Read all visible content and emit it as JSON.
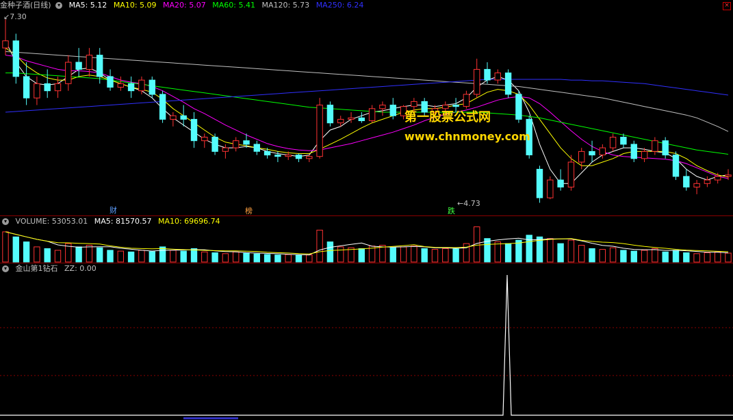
{
  "main_header": {
    "title": "金种子酒(日线)",
    "ma5": "MA5: 5.12",
    "ma10": "MA10: 5.09",
    "ma20": "MA20: 5.07",
    "ma60": "MA60: 5.41",
    "ma120": "MA120: 5.73",
    "ma250": "MA250: 6.24"
  },
  "volume_header": {
    "volume": "VOLUME: 53053.01",
    "ma5": "MA5: 81570.57",
    "ma10": "MA10: 69696.74"
  },
  "indicator_header": {
    "name": "金山第1钻石",
    "zz": "ZZ: 0.00"
  },
  "watermark": {
    "line1": "第一股票公式网",
    "line2": "www.chnmoney.com"
  },
  "markers": {
    "high_price": "7.30",
    "low_price": "4.73",
    "tag_cai": "财",
    "tag_bang": "榜",
    "tag_die": "跌"
  },
  "colors": {
    "up": "#ff3232",
    "down": "#54fcfc",
    "ma5": "#ffffff",
    "ma10": "#ffff00",
    "ma20": "#ff00ff",
    "ma60": "#00ff00",
    "ma120": "#c0c0c0",
    "ma250": "#3030ff"
  },
  "chart_data": [
    {
      "type": "candlestick",
      "title": "金种子酒(日线)",
      "ylim": [
        4.6,
        7.4
      ],
      "candles": [
        [
          6.9,
          7.3,
          7.0,
          6.8
        ],
        [
          7.0,
          7.1,
          6.5,
          6.4
        ],
        [
          6.5,
          6.7,
          6.2,
          6.1
        ],
        [
          6.2,
          6.5,
          6.4,
          6.1
        ],
        [
          6.4,
          6.6,
          6.3,
          6.2
        ],
        [
          6.3,
          6.5,
          6.4,
          6.2
        ],
        [
          6.4,
          6.8,
          6.7,
          6.3
        ],
        [
          6.7,
          6.9,
          6.6,
          6.5
        ],
        [
          6.6,
          6.9,
          6.8,
          6.5
        ],
        [
          6.8,
          6.9,
          6.5,
          6.4
        ],
        [
          6.5,
          6.6,
          6.35,
          6.3
        ],
        [
          6.35,
          6.5,
          6.4,
          6.3
        ],
        [
          6.4,
          6.5,
          6.3,
          6.2
        ],
        [
          6.3,
          6.5,
          6.45,
          6.25
        ],
        [
          6.45,
          6.5,
          6.25,
          6.2
        ],
        [
          6.25,
          6.3,
          5.9,
          5.85
        ],
        [
          5.9,
          6.0,
          5.95,
          5.8
        ],
        [
          5.95,
          6.1,
          5.9,
          5.8
        ],
        [
          5.9,
          6.0,
          5.6,
          5.5
        ],
        [
          5.6,
          5.7,
          5.65,
          5.5
        ],
        [
          5.65,
          5.7,
          5.45,
          5.4
        ],
        [
          5.45,
          5.55,
          5.5,
          5.35
        ],
        [
          5.5,
          5.65,
          5.6,
          5.45
        ],
        [
          5.6,
          5.7,
          5.55,
          5.5
        ],
        [
          5.55,
          5.6,
          5.45,
          5.4
        ],
        [
          5.45,
          5.5,
          5.4,
          5.35
        ],
        [
          5.4,
          5.45,
          5.38,
          5.3
        ],
        [
          5.38,
          5.45,
          5.4,
          5.33
        ],
        [
          5.4,
          5.42,
          5.35,
          5.3
        ],
        [
          5.35,
          5.4,
          5.38,
          5.3
        ],
        [
          5.38,
          6.2,
          6.1,
          5.35
        ],
        [
          6.1,
          6.15,
          5.85,
          5.8
        ],
        [
          5.85,
          5.95,
          5.9,
          5.8
        ],
        [
          5.9,
          6.0,
          5.92,
          5.85
        ],
        [
          5.92,
          6.0,
          5.88,
          5.85
        ],
        [
          5.88,
          6.1,
          6.05,
          5.85
        ],
        [
          6.05,
          6.15,
          6.1,
          5.95
        ],
        [
          6.1,
          6.2,
          5.95,
          5.9
        ],
        [
          5.95,
          6.1,
          6.08,
          5.9
        ],
        [
          6.08,
          6.2,
          6.15,
          6.0
        ],
        [
          6.15,
          6.2,
          6.0,
          5.95
        ],
        [
          6.0,
          6.1,
          6.05,
          5.95
        ],
        [
          6.05,
          6.15,
          6.1,
          6.0
        ],
        [
          6.1,
          6.2,
          6.08,
          6.0
        ],
        [
          6.08,
          6.3,
          6.25,
          6.05
        ],
        [
          6.25,
          6.75,
          6.6,
          6.2
        ],
        [
          6.6,
          6.7,
          6.45,
          6.4
        ],
        [
          6.45,
          6.6,
          6.55,
          6.4
        ],
        [
          6.55,
          6.6,
          6.25,
          6.2
        ],
        [
          6.25,
          6.3,
          5.9,
          5.85
        ],
        [
          5.9,
          5.95,
          5.4,
          5.35
        ],
        [
          5.2,
          5.25,
          4.8,
          4.73
        ],
        [
          4.8,
          5.1,
          5.05,
          4.78
        ],
        [
          5.05,
          5.2,
          4.95,
          4.9
        ],
        [
          4.95,
          5.4,
          5.3,
          4.9
        ],
        [
          5.3,
          5.5,
          5.45,
          5.2
        ],
        [
          5.45,
          5.6,
          5.4,
          5.3
        ],
        [
          5.4,
          5.55,
          5.5,
          5.35
        ],
        [
          5.5,
          5.7,
          5.65,
          5.45
        ],
        [
          5.65,
          5.7,
          5.55,
          5.5
        ],
        [
          5.55,
          5.6,
          5.35,
          5.3
        ],
        [
          5.35,
          5.5,
          5.45,
          5.3
        ],
        [
          5.45,
          5.65,
          5.6,
          5.4
        ],
        [
          5.6,
          5.65,
          5.4,
          5.35
        ],
        [
          5.4,
          5.45,
          5.1,
          5.05
        ],
        [
          5.1,
          5.2,
          4.95,
          4.9
        ],
        [
          4.95,
          5.05,
          5.0,
          4.85
        ],
        [
          5.0,
          5.1,
          5.05,
          4.95
        ],
        [
          5.05,
          5.15,
          5.1,
          5.0
        ],
        [
          5.1,
          5.2,
          5.12,
          5.05
        ]
      ],
      "ma_series": [
        {
          "name": "MA5",
          "values": [
            7.0,
            6.7,
            6.5,
            6.4,
            6.38,
            6.4,
            6.5,
            6.6,
            6.62,
            6.55,
            6.45,
            6.4,
            6.35,
            6.3,
            6.2,
            6.05,
            5.92,
            5.82,
            5.72,
            5.62,
            5.55,
            5.5,
            5.5,
            5.52,
            5.5,
            5.45,
            5.42,
            5.4,
            5.38,
            5.4,
            5.6,
            5.75,
            5.8,
            5.9,
            5.95,
            6.0,
            6.02,
            6.05,
            6.08,
            6.1,
            6.1,
            6.08,
            6.1,
            6.12,
            6.2,
            6.35,
            6.45,
            6.5,
            6.45,
            6.3,
            6.0,
            5.55,
            5.2,
            5.0,
            5.0,
            5.15,
            5.3,
            5.4,
            5.45,
            5.5,
            5.5,
            5.48,
            5.45,
            5.43,
            5.35,
            5.2,
            5.1,
            5.05,
            5.1,
            5.12
          ]
        },
        {
          "name": "MA10",
          "values": [
            6.9,
            6.8,
            6.65,
            6.55,
            6.48,
            6.45,
            6.45,
            6.5,
            6.52,
            6.5,
            6.45,
            6.4,
            6.35,
            6.32,
            6.28,
            6.18,
            6.05,
            5.95,
            5.85,
            5.75,
            5.65,
            5.58,
            5.55,
            5.53,
            5.5,
            5.48,
            5.45,
            5.43,
            5.42,
            5.42,
            5.48,
            5.55,
            5.62,
            5.7,
            5.78,
            5.85,
            5.9,
            5.95,
            6.0,
            6.03,
            6.05,
            6.05,
            6.07,
            6.1,
            6.12,
            6.2,
            6.28,
            6.32,
            6.3,
            6.25,
            6.1,
            5.9,
            5.7,
            5.5,
            5.35,
            5.25,
            5.25,
            5.3,
            5.35,
            5.42,
            5.45,
            5.45,
            5.45,
            5.45,
            5.42,
            5.35,
            5.25,
            5.18,
            5.12,
            5.09
          ]
        },
        {
          "name": "MA20",
          "values": [
            6.8,
            6.78,
            6.72,
            6.68,
            6.64,
            6.6,
            6.58,
            6.58,
            6.57,
            6.55,
            6.5,
            6.45,
            6.42,
            6.4,
            6.36,
            6.3,
            6.22,
            6.14,
            6.05,
            5.98,
            5.9,
            5.82,
            5.75,
            5.68,
            5.62,
            5.56,
            5.52,
            5.49,
            5.47,
            5.46,
            5.47,
            5.5,
            5.53,
            5.56,
            5.6,
            5.64,
            5.68,
            5.72,
            5.77,
            5.82,
            5.88,
            5.93,
            5.97,
            6.0,
            6.03,
            6.07,
            6.12,
            6.17,
            6.2,
            6.22,
            6.2,
            6.12,
            6.0,
            5.87,
            5.74,
            5.62,
            5.52,
            5.45,
            5.4,
            5.38,
            5.37,
            5.36,
            5.35,
            5.34,
            5.32,
            5.28,
            5.22,
            5.16,
            5.1,
            5.07
          ]
        },
        {
          "name": "MA60",
          "values": [
            6.55,
            6.55,
            6.54,
            6.53,
            6.52,
            6.51,
            6.5,
            6.49,
            6.48,
            6.47,
            6.45,
            6.43,
            6.41,
            6.39,
            6.37,
            6.35,
            6.33,
            6.31,
            6.29,
            6.27,
            6.25,
            6.23,
            6.21,
            6.19,
            6.17,
            6.15,
            6.13,
            6.11,
            6.09,
            6.07,
            6.06,
            6.05,
            6.04,
            6.03,
            6.02,
            6.01,
            6.0,
            6.0,
            6.0,
            6.0,
            6.0,
            6.0,
            6.0,
            6.0,
            6.0,
            6.0,
            5.99,
            5.98,
            5.97,
            5.96,
            5.94,
            5.92,
            5.89,
            5.86,
            5.83,
            5.8,
            5.77,
            5.74,
            5.71,
            5.68,
            5.65,
            5.62,
            5.59,
            5.56,
            5.53,
            5.5,
            5.47,
            5.45,
            5.43,
            5.41
          ]
        },
        {
          "name": "MA120",
          "values": [
            6.85,
            6.84,
            6.83,
            6.82,
            6.81,
            6.8,
            6.79,
            6.78,
            6.77,
            6.76,
            6.75,
            6.74,
            6.73,
            6.72,
            6.71,
            6.7,
            6.69,
            6.68,
            6.67,
            6.66,
            6.65,
            6.64,
            6.63,
            6.62,
            6.61,
            6.6,
            6.59,
            6.58,
            6.57,
            6.56,
            6.55,
            6.54,
            6.53,
            6.52,
            6.51,
            6.5,
            6.49,
            6.48,
            6.47,
            6.46,
            6.45,
            6.44,
            6.43,
            6.42,
            6.41,
            6.4,
            6.39,
            6.38,
            6.37,
            6.36,
            6.34,
            6.32,
            6.3,
            6.28,
            6.26,
            6.24,
            6.22,
            6.2,
            6.17,
            6.14,
            6.11,
            6.08,
            6.05,
            6.02,
            5.99,
            5.96,
            5.92,
            5.86,
            5.8,
            5.73
          ]
        },
        {
          "name": "MA250",
          "values": [
            6.0,
            6.01,
            6.02,
            6.03,
            6.04,
            6.05,
            6.06,
            6.07,
            6.08,
            6.09,
            6.1,
            6.11,
            6.12,
            6.13,
            6.14,
            6.15,
            6.16,
            6.17,
            6.18,
            6.19,
            6.2,
            6.21,
            6.22,
            6.23,
            6.24,
            6.25,
            6.26,
            6.27,
            6.28,
            6.29,
            6.3,
            6.31,
            6.32,
            6.33,
            6.34,
            6.35,
            6.36,
            6.37,
            6.38,
            6.39,
            6.4,
            6.41,
            6.42,
            6.43,
            6.44,
            6.45,
            6.46,
            6.46,
            6.46,
            6.46,
            6.46,
            6.46,
            6.46,
            6.46,
            6.45,
            6.45,
            6.44,
            6.44,
            6.43,
            6.42,
            6.41,
            6.4,
            6.38,
            6.36,
            6.34,
            6.32,
            6.3,
            6.28,
            6.26,
            6.24
          ]
        }
      ]
    },
    {
      "type": "bar",
      "title": "VOLUME",
      "ylim": [
        0,
        200000
      ],
      "values": [
        180000,
        150000,
        120000,
        90000,
        80000,
        70000,
        110000,
        90000,
        100000,
        85000,
        70000,
        65000,
        60000,
        70000,
        62000,
        90000,
        70000,
        65000,
        80000,
        60000,
        55000,
        50000,
        60000,
        52000,
        48000,
        45000,
        42000,
        44000,
        40000,
        42000,
        190000,
        120000,
        90000,
        85000,
        80000,
        95000,
        100000,
        85000,
        90000,
        95000,
        80000,
        75000,
        80000,
        78000,
        110000,
        210000,
        140000,
        120000,
        110000,
        130000,
        160000,
        150000,
        140000,
        110000,
        130000,
        100000,
        80000,
        75000,
        85000,
        70000,
        65000,
        70000,
        80000,
        60000,
        70000,
        55000,
        50000,
        55000,
        60000,
        53053
      ]
    },
    {
      "type": "line",
      "title": "金山第1钻石",
      "ylim": [
        0,
        1
      ],
      "values": [
        0,
        0,
        0,
        0,
        0,
        0,
        0,
        0,
        0,
        0,
        0,
        0,
        0,
        0,
        0,
        0,
        0,
        0,
        0,
        0,
        0,
        0,
        0,
        0,
        0,
        0,
        0,
        0,
        0,
        0,
        0,
        0,
        0,
        0,
        0,
        0,
        0,
        0,
        0,
        0,
        0,
        0,
        0,
        0,
        0,
        0,
        0,
        0,
        0,
        0,
        0,
        0,
        0,
        0,
        0,
        0,
        0,
        0,
        0,
        0,
        0,
        0,
        0,
        0,
        0,
        0,
        0,
        0,
        0,
        0
      ],
      "spike_value": 1
    }
  ]
}
